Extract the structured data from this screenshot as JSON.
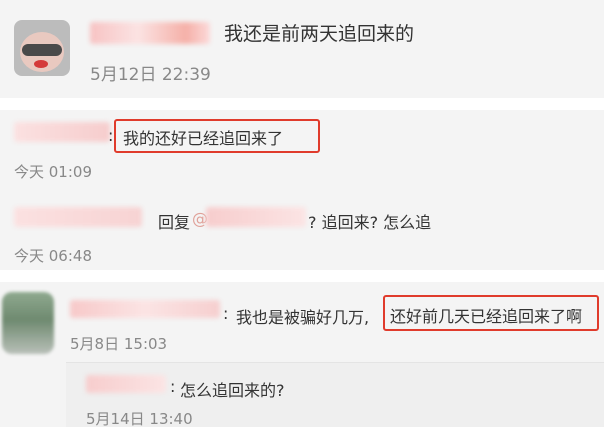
{
  "comment1": {
    "text": "我还是前两天追回来的",
    "timestamp": "5月12日 22:39"
  },
  "reply1": {
    "colon": ":",
    "text": "我的还好已经追回来了",
    "timestamp": "今天 01:09"
  },
  "reply2": {
    "reply_word": "回复",
    "mention_prefix": "@",
    "text": "? 追回来? 怎么追",
    "timestamp": "今天 06:48"
  },
  "comment2": {
    "colon": ":",
    "text_plain": "我也是被骗好几万,",
    "text_highlight": "还好前几天已经追回来了啊",
    "timestamp": "5月8日 15:03",
    "sub_reply": {
      "colon": ":",
      "text": "怎么追回来的?",
      "timestamp": "5月14日 13:40"
    }
  },
  "colors": {
    "highlight_border": "#e03b2c",
    "background": "#f4f4f4",
    "text": "#333333",
    "timestamp": "#888888"
  }
}
